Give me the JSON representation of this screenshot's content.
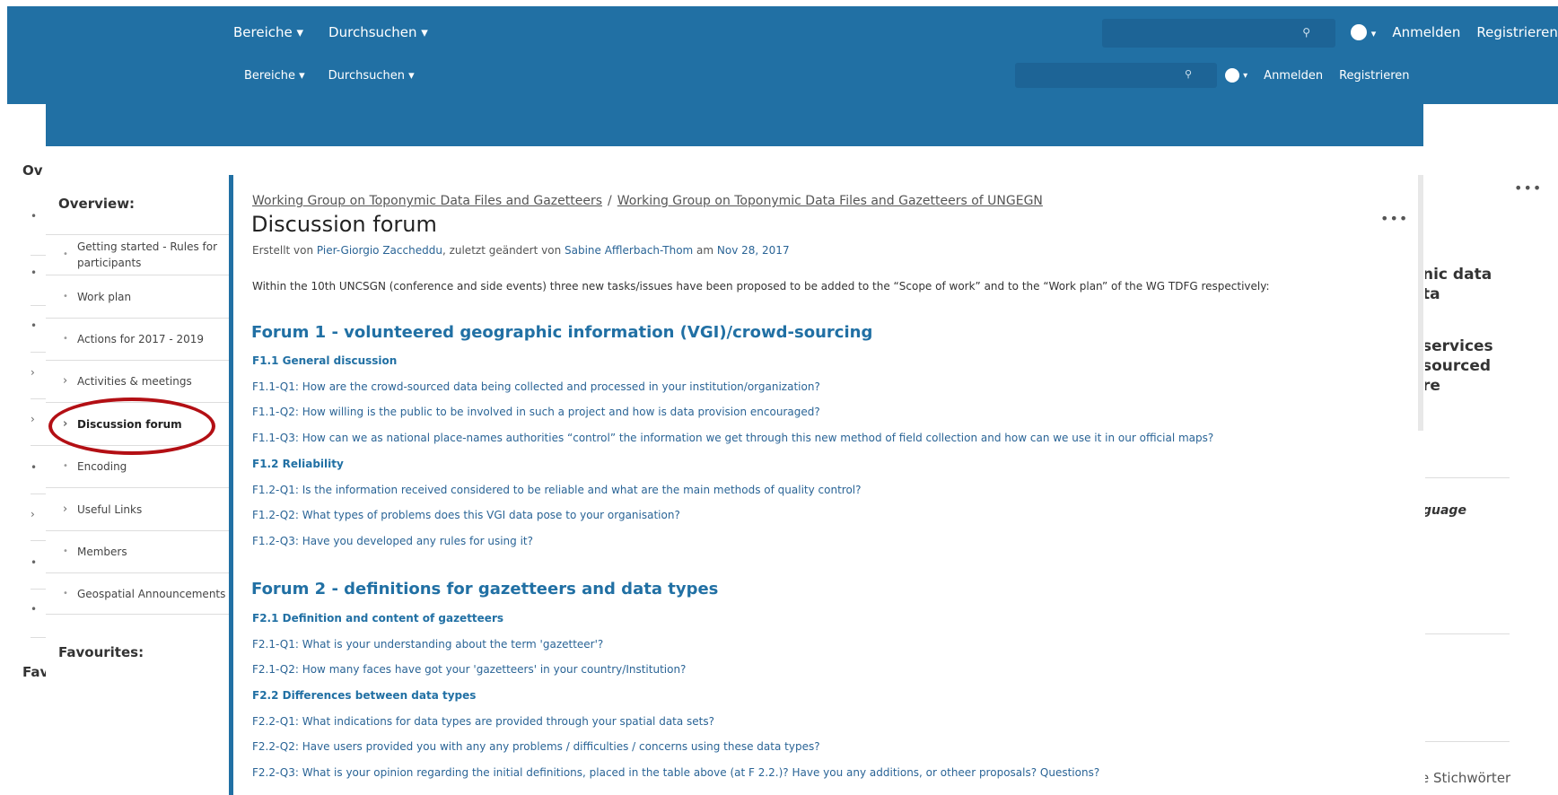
{
  "outer": {
    "nav": [
      "Bereiche ▾",
      "Durchsuchen ▾"
    ],
    "help": "?",
    "help_caret": "▾",
    "login": "Anmelden",
    "register": "Registrieren",
    "left_fragments": {
      "overview": "Ov",
      "favourites": "Fav"
    },
    "right_fragments": [
      "nic data",
      "ta",
      "services",
      "sourced",
      "re",
      "guage"
    ],
    "right_dots": "•••",
    "stichwoerter": "e Stichwörter"
  },
  "header": {
    "nav": [
      "Bereiche ▾",
      "Durchsuchen ▾"
    ],
    "help": "?",
    "help_caret": "▾",
    "login": "Anmelden",
    "register": "Registrieren"
  },
  "sidebar": {
    "overview_heading": "Overview:",
    "favourites_heading": "Favourites:",
    "items": [
      {
        "label": "Getting started - Rules for participants",
        "mark": "•"
      },
      {
        "label": "Work plan",
        "mark": "•"
      },
      {
        "label": "Actions for 2017 - 2019",
        "mark": "•"
      },
      {
        "label": "Activities & meetings",
        "mark": "›"
      },
      {
        "label": "Discussion forum",
        "mark": "›"
      },
      {
        "label": "Encoding",
        "mark": "•"
      },
      {
        "label": "Useful Links",
        "mark": "›"
      },
      {
        "label": "Members",
        "mark": "•"
      },
      {
        "label": "Geospatial Announcements",
        "mark": "•"
      }
    ]
  },
  "page": {
    "breadcrumb": [
      "Working Group on Toponymic Data Files and Gazetteers",
      "Working Group on Toponymic Data Files and Gazetteers of UNGEGN"
    ],
    "breadcrumb_sep": "/",
    "title": "Discussion forum",
    "more_dots": "•••",
    "meta": {
      "created_by_prefix": "Erstellt von ",
      "creator": "Pier-Giorgio Zaccheddu",
      "changed_by_prefix": ", zuletzt geändert von ",
      "editor": "Sabine Afflerbach-Thom",
      "date_prefix": " am ",
      "date": "Nov 28, 2017"
    },
    "intro": "Within the 10th UNCSGN (conference and side events) three new tasks/issues have been proposed to be added to the “Scope of work” and to the “Work plan” of the WG TDFG respectively:"
  },
  "forums": {
    "f1_title": "Forum 1 - volunteered geographic information (VGI)/crowd-sourcing",
    "f1_s1": "F1.1 General discussion",
    "f1_s1_q1": "F1.1-Q1: How are the crowd-sourced data being collected and processed in your institution/organization?",
    "f1_s1_q2": "F1.1-Q2: How willing is the public to be involved in such a project and how is data provision encouraged?",
    "f1_s1_q3": "F1.1-Q3: How can we as national place-names authorities “control” the information we get through this new method of field collection and how can we use it in our official maps?",
    "f1_s2": "F1.2 Reliability",
    "f1_s2_q1": "F1.2-Q1: Is the information received considered to be reliable and what are the main methods of quality control?",
    "f1_s2_q2": "F1.2-Q2: What types of problems does this VGI data pose to your organisation?",
    "f1_s2_q3": "F1.2-Q3: Have you developed any rules for using it?",
    "f2_title": "Forum 2 - definitions for gazetteers and data types",
    "f2_s1": "F2.1 Definition and content of gazetteers",
    "f2_s1_q1": "F2.1-Q1: What is your understanding about the term 'gazetteer'?",
    "f2_s1_q2": "F2.1-Q2: How many faces have got your 'gazetteers' in your country/Institution?",
    "f2_s2": "F2.2 Differences between data types",
    "f2_s2_q1": "F2.2-Q1: What indications for data types are provided through your spatial data sets?",
    "f2_s2_q2": "F2.2-Q2: Have users provided you with any any problems / difficulties / concerns using these data types?",
    "f2_s2_q3": "F2.2-Q3: What is your opinion regarding the initial definitions, placed in the table above (at F 2.2.)? Have you any additions, or otheer proposals? Questions?"
  },
  "colors": {
    "header": "#2170a4",
    "link": "#2a6496",
    "highlight": "#b30f14"
  }
}
